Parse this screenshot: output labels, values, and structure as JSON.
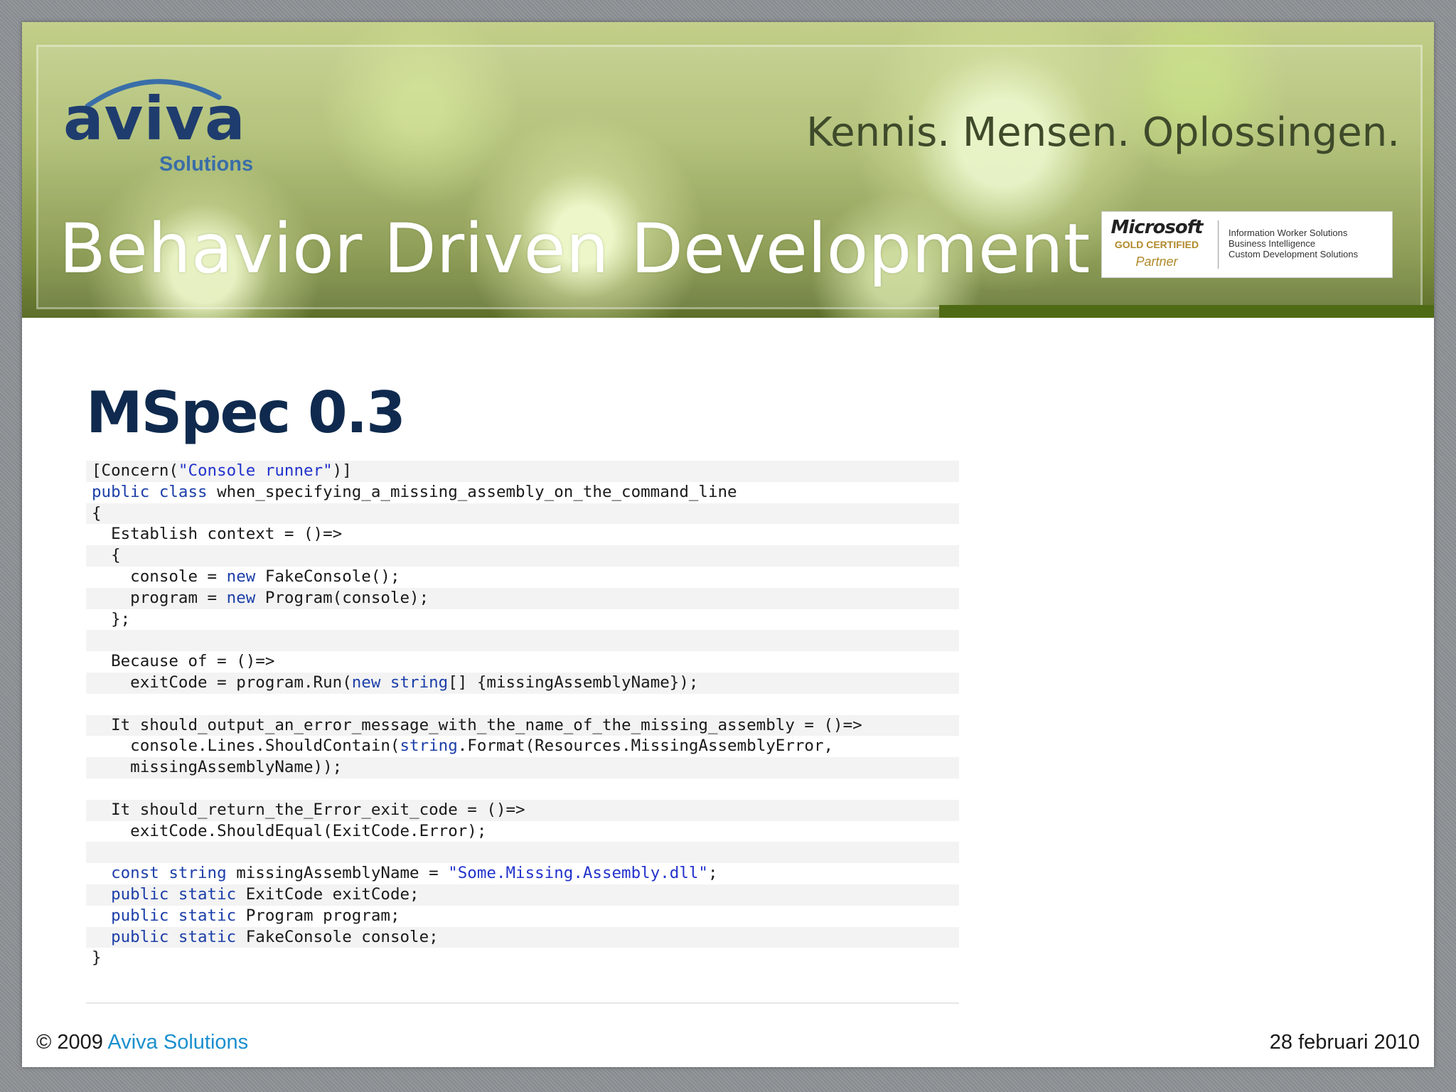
{
  "header": {
    "logo_word": "aviva",
    "logo_sub": "Solutions",
    "tagline": "Kennis. Mensen. Oplossingen.",
    "title": "Behavior Driven Development",
    "badge": {
      "brand": "Microsoft",
      "level": "GOLD CERTIFIED",
      "partner": "Partner",
      "competencies": [
        "Information Worker Solutions",
        "Business Intelligence",
        "Custom Development Solutions"
      ]
    }
  },
  "slide": {
    "heading": "MSpec 0.3"
  },
  "code": {
    "lines": [
      [
        {
          "t": "[Concern("
        },
        {
          "t": "\"Console runner\"",
          "c": "str"
        },
        {
          "t": ")]"
        }
      ],
      [
        {
          "t": "public class",
          "c": "kw"
        },
        {
          "t": " when_specifying_a_missing_assembly_on_the_command_line"
        }
      ],
      [
        {
          "t": "{"
        }
      ],
      [
        {
          "t": "  Establish context = ()=>"
        }
      ],
      [
        {
          "t": "  {"
        }
      ],
      [
        {
          "t": "    console = "
        },
        {
          "t": "new",
          "c": "kw"
        },
        {
          "t": " FakeConsole();"
        }
      ],
      [
        {
          "t": "    program = "
        },
        {
          "t": "new",
          "c": "kw"
        },
        {
          "t": " Program(console);"
        }
      ],
      [
        {
          "t": "  };"
        }
      ],
      [
        {
          "t": ""
        }
      ],
      [
        {
          "t": "  Because of = ()=>"
        }
      ],
      [
        {
          "t": "    exitCode = program.Run("
        },
        {
          "t": "new string",
          "c": "kw"
        },
        {
          "t": "[] {missingAssemblyName});"
        }
      ],
      [
        {
          "t": ""
        }
      ],
      [
        {
          "t": "  It should_output_an_error_message_with_the_name_of_the_missing_assembly = ()=>"
        }
      ],
      [
        {
          "t": "    console.Lines.ShouldContain("
        },
        {
          "t": "string",
          "c": "kw"
        },
        {
          "t": ".Format(Resources.MissingAssemblyError,"
        }
      ],
      [
        {
          "t": "    missingAssemblyName));"
        }
      ],
      [
        {
          "t": ""
        }
      ],
      [
        {
          "t": "  It should_return_the_Error_exit_code = ()=>"
        }
      ],
      [
        {
          "t": "    exitCode.ShouldEqual(ExitCode.Error);"
        }
      ],
      [
        {
          "t": ""
        }
      ],
      [
        {
          "t": "  "
        },
        {
          "t": "const string",
          "c": "kw"
        },
        {
          "t": " missingAssemblyName = "
        },
        {
          "t": "\"Some.Missing.Assembly.dll\"",
          "c": "str"
        },
        {
          "t": ";"
        }
      ],
      [
        {
          "t": "  "
        },
        {
          "t": "public static",
          "c": "kw"
        },
        {
          "t": " ExitCode exitCode;"
        }
      ],
      [
        {
          "t": "  "
        },
        {
          "t": "public static",
          "c": "kw"
        },
        {
          "t": " Program program;"
        }
      ],
      [
        {
          "t": "  "
        },
        {
          "t": "public static",
          "c": "kw"
        },
        {
          "t": " FakeConsole console;"
        }
      ],
      [
        {
          "t": "}"
        }
      ]
    ]
  },
  "footer": {
    "copyright": "© 2009 ",
    "company": "Aviva Solutions",
    "date": "28 februari 2010"
  }
}
